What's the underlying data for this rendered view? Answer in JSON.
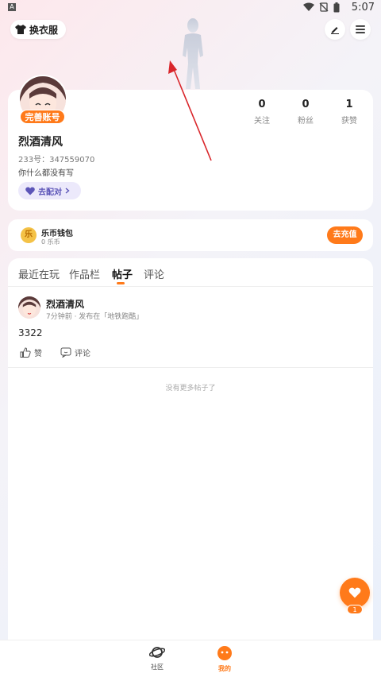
{
  "status_bar": {
    "time": "5:07",
    "app_indicator": "A"
  },
  "header": {
    "dress_button_label": "换衣服",
    "edit_icon": "pencil-icon",
    "menu_icon": "hamburger-menu-icon"
  },
  "profile": {
    "complete_badge": "完善账号",
    "username": "烈酒清风",
    "uid": "233号：347559070",
    "bio": "你什么都没有写",
    "match_button": "去配对",
    "stats": [
      {
        "value": "0",
        "label": "关注"
      },
      {
        "value": "0",
        "label": "粉丝"
      },
      {
        "value": "1",
        "label": "获赞"
      }
    ]
  },
  "wallet": {
    "coin_glyph": "乐",
    "title": "乐币钱包",
    "amount": "0 乐币",
    "recharge_button": "去充值"
  },
  "tabs": [
    {
      "label": "最近在玩",
      "active": false
    },
    {
      "label": "作品栏",
      "active": false
    },
    {
      "label": "帖子",
      "active": true
    },
    {
      "label": "评论",
      "active": false
    }
  ],
  "post": {
    "author": "烈酒清风",
    "meta": "7分钟前 · 发布在「地铁跑酷」",
    "content": "3322",
    "like_label": "赞",
    "comment_label": "评论"
  },
  "no_more_text": "没有更多帖子了",
  "fab": {
    "count": "1",
    "icon": "heart-icon"
  },
  "bottom_nav": [
    {
      "label": "社区",
      "icon": "planet-icon",
      "active": false
    },
    {
      "label": "我的",
      "icon": "face-icon",
      "active": true
    }
  ],
  "colors": {
    "accent": "#ff7a1a",
    "match_bg": "#ece9fb",
    "match_text": "#5c55b8"
  }
}
